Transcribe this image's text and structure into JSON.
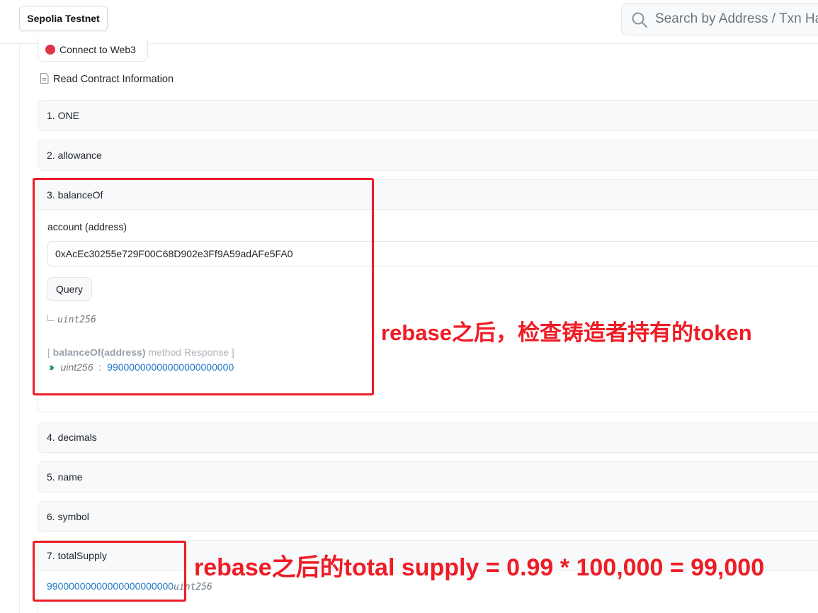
{
  "header": {
    "network_label": "Sepolia Testnet",
    "search_placeholder": "Search by Address / Txn Hash / Block / Token / Domain Name"
  },
  "contract": {
    "connect_label": "Connect to Web3",
    "read_info_label": "Read Contract Information",
    "functions": [
      {
        "label": "1. ONE"
      },
      {
        "label": "2. allowance"
      },
      {
        "label": "3. balanceOf",
        "param_label": "account (address)",
        "param_value": "0xAcEc30255e729F00C68D902e3Ff9A59adAFe5FA0",
        "query_label": "Query",
        "output_type": "uint256",
        "response_open": "[",
        "response_method": "balanceOf(address)",
        "response_suffix": "method Response ]",
        "response_type": "uint256",
        "response_colon": ":",
        "response_value": "99000000000000000000000"
      },
      {
        "label": "4. decimals"
      },
      {
        "label": "5. name"
      },
      {
        "label": "6. symbol"
      },
      {
        "label": "7. totalSupply",
        "value": "99000000000000000000000",
        "type": "uint256"
      }
    ]
  },
  "annotations": {
    "balance_note": "rebase之后，检查铸造者持有的token",
    "supply_note": "rebase之后的total supply = 0.99 * 100,000 = 99,000",
    "color": "#ee1c25"
  }
}
